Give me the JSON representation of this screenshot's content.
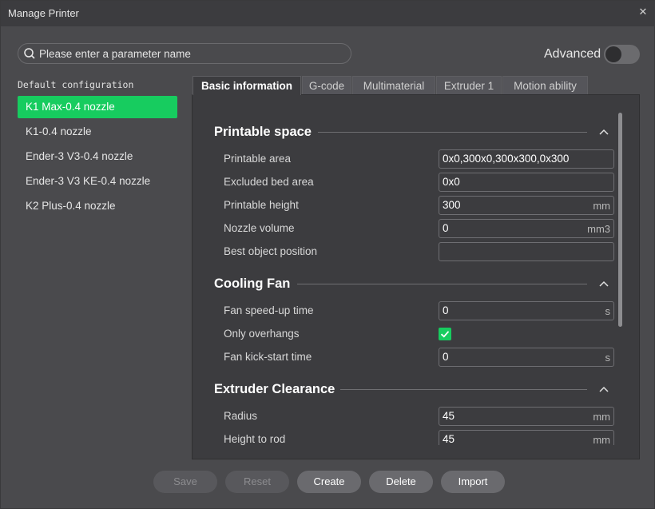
{
  "window": {
    "title": "Manage Printer",
    "close_glyph": "✕"
  },
  "search": {
    "placeholder": "Please enter a parameter name",
    "value": ""
  },
  "advanced": {
    "label": "Advanced",
    "enabled": false
  },
  "sidebar": {
    "heading": "Default configuration",
    "items": [
      {
        "label": "K1 Max-0.4 nozzle",
        "selected": true
      },
      {
        "label": "K1-0.4 nozzle",
        "selected": false
      },
      {
        "label": "Ender-3 V3-0.4 nozzle",
        "selected": false
      },
      {
        "label": "Ender-3 V3 KE-0.4 nozzle",
        "selected": false
      },
      {
        "label": "K2 Plus-0.4 nozzle",
        "selected": false
      }
    ]
  },
  "tabs": [
    {
      "label": "Basic information",
      "active": true
    },
    {
      "label": "G-code",
      "active": false
    },
    {
      "label": "Multimaterial",
      "active": false
    },
    {
      "label": "Extruder 1",
      "active": false
    },
    {
      "label": "Motion ability",
      "active": false
    }
  ],
  "sections": {
    "printable_space": {
      "title": "Printable space",
      "rows": {
        "printable_area": {
          "label": "Printable area",
          "value": "0x0,300x0,300x300,0x300",
          "unit": ""
        },
        "excluded_bed_area": {
          "label": "Excluded bed area",
          "value": "0x0",
          "unit": ""
        },
        "printable_height": {
          "label": "Printable height",
          "value": "300",
          "unit": "mm"
        },
        "nozzle_volume": {
          "label": "Nozzle volume",
          "value": "0",
          "unit": "mm3"
        },
        "best_object_position": {
          "label": "Best object position",
          "value": "",
          "unit": ""
        }
      }
    },
    "cooling_fan": {
      "title": "Cooling Fan",
      "rows": {
        "fan_speedup_time": {
          "label": "Fan speed-up time",
          "value": "0",
          "unit": "s"
        },
        "only_overhangs": {
          "label": "Only overhangs",
          "checked": true
        },
        "fan_kickstart_time": {
          "label": "Fan kick-start time",
          "value": "0",
          "unit": "s"
        }
      }
    },
    "extruder_clearance": {
      "title": "Extruder Clearance",
      "rows": {
        "radius": {
          "label": "Radius",
          "value": "45",
          "unit": "mm"
        },
        "height_to_rod": {
          "label": "Height to rod",
          "value": "45",
          "unit": "mm"
        }
      }
    }
  },
  "footer": {
    "save": "Save",
    "reset": "Reset",
    "create": "Create",
    "delete": "Delete",
    "import": "Import"
  },
  "colors": {
    "accent": "#17cc5f",
    "window_bg": "#4a4a4d",
    "panel_bg": "#3c3c3f",
    "titlebar_bg": "#3c3c3f"
  }
}
